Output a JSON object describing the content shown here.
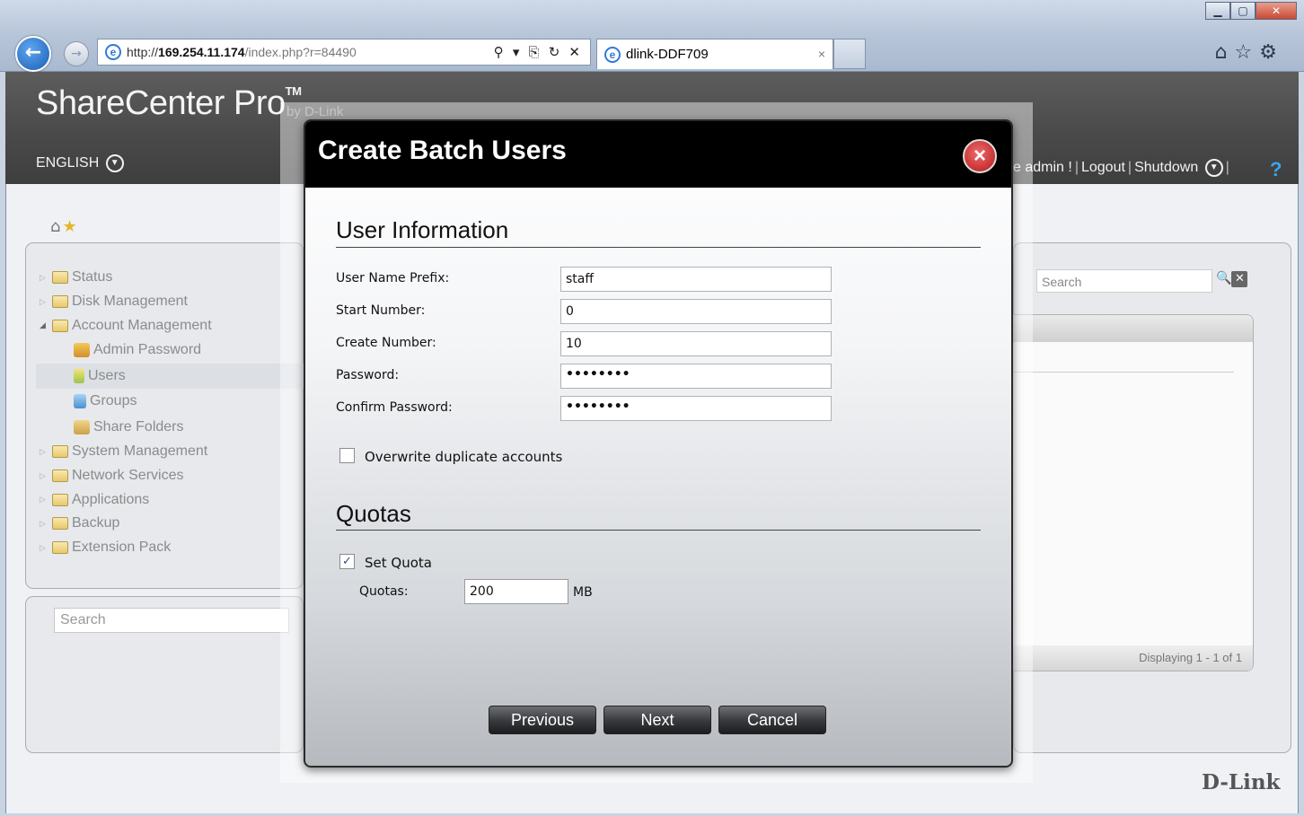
{
  "browser": {
    "url_prefix": "http://",
    "url_host": "169.254.11.174",
    "url_path": "/index.php?r=84490",
    "url_tools": "⚲ ▾ ⎘ ↻ ✕",
    "tab_title": "dlink-DDF709",
    "tab_close": "×",
    "window_buttons": [
      "▁",
      "▢",
      "✕"
    ],
    "icons": [
      "home-icon",
      "favorites-star-icon",
      "settings-gear-icon"
    ]
  },
  "header": {
    "brand": "ShareCenter Pro",
    "brand_tm": "TM",
    "brand_by": "by D-Link",
    "language": "ENGLISH",
    "welcome_partial": "e admin !",
    "logout": "Logout",
    "shutdown": "Shutdown"
  },
  "nav": {
    "items": [
      {
        "label": "Status"
      },
      {
        "label": "Disk Management"
      },
      {
        "label": "Account Management"
      },
      {
        "label": "Admin Password"
      },
      {
        "label": "Users"
      },
      {
        "label": "Groups"
      },
      {
        "label": "Share Folders"
      },
      {
        "label": "System Management"
      },
      {
        "label": "Network Services"
      },
      {
        "label": "Applications"
      },
      {
        "label": "Backup"
      },
      {
        "label": "Extension Pack"
      }
    ],
    "search_placeholder": "Search"
  },
  "right_panel": {
    "search_placeholder": "Search",
    "footer": "Displaying 1 - 1 of 1"
  },
  "footer_logo": "D-Link",
  "modal": {
    "title": "Create Batch Users",
    "close": "×",
    "section_user_info": "User Information",
    "fields": {
      "prefix_label": "User Name Prefix:",
      "prefix_value": "staff",
      "start_label": "Start Number:",
      "start_value": "0",
      "create_label": "Create Number:",
      "create_value": "10",
      "password_label": "Password:",
      "password_value": "••••••••",
      "confirm_label": "Confirm Password:",
      "confirm_value": "••••••••"
    },
    "overwrite_label": "Overwrite duplicate accounts",
    "overwrite_checked": false,
    "section_quotas": "Quotas",
    "set_quota_label": "Set Quota",
    "set_quota_checked": true,
    "quotas_label": "Quotas:",
    "quotas_value": "200",
    "quotas_unit": "MB",
    "buttons": {
      "previous": "Previous",
      "next": "Next",
      "cancel": "Cancel"
    }
  }
}
